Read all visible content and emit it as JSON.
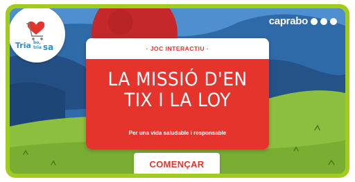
{
  "brand": {
    "name": "caprabo",
    "dots": 3
  },
  "logo": {
    "word_tria_1": "Tria",
    "word_bo": "bo,",
    "word_tria_2": "tria",
    "word_sa": "sa"
  },
  "panel": {
    "kicker": "· JOC INTERACTIU ·",
    "title_line_1": "LA MISSIÓ D'EN",
    "title_line_2": "TIX I LA LOY",
    "subtitle": "Per una vida saludable i responsable"
  },
  "actions": {
    "start_label": "COMENÇAR"
  },
  "colors": {
    "frame": "#9fcc1f",
    "accent_red": "#e4342c",
    "sky_blue": "#2a5f9a",
    "grass_green": "#8cbf3f"
  }
}
